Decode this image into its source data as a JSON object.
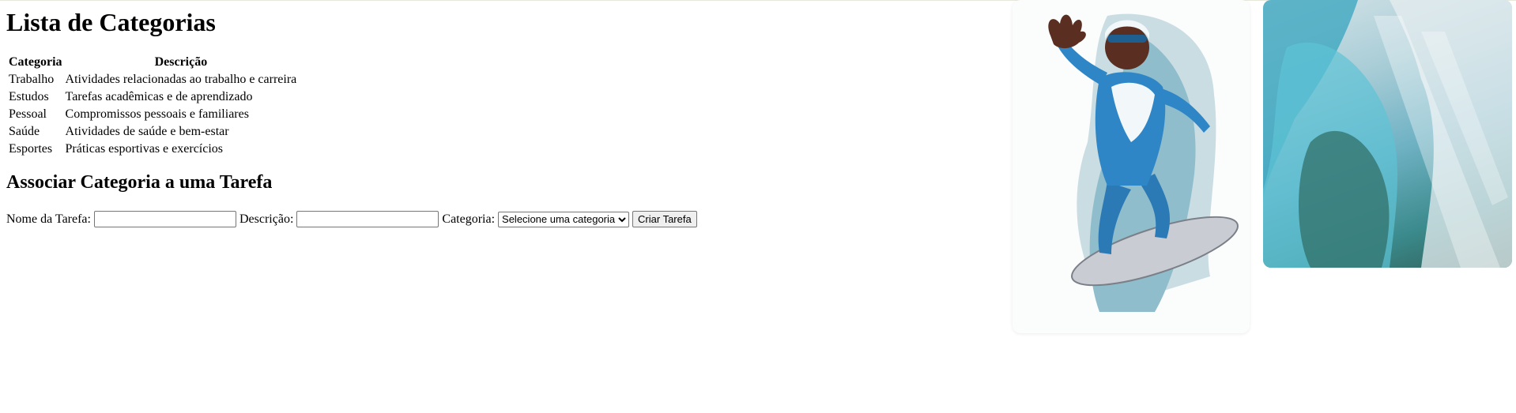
{
  "title": "Lista de Categorias",
  "table": {
    "headers": [
      "Categoria",
      "Descrição"
    ],
    "rows": [
      [
        "Trabalho",
        "Atividades relacionadas ao trabalho e carreira"
      ],
      [
        "Estudos",
        "Tarefas acadêmicas e de aprendizado"
      ],
      [
        "Pessoal",
        "Compromissos pessoais e familiares"
      ],
      [
        "Saúde",
        "Atividades de saúde e bem-estar"
      ],
      [
        "Esportes",
        "Práticas esportivas e exercícios"
      ]
    ]
  },
  "subtitle": "Associar Categoria a uma Tarefa",
  "form": {
    "nome_label": "Nome da Tarefa:",
    "nome_value": "",
    "descricao_label": "Descrição:",
    "descricao_value": "",
    "categoria_label": "Categoria:",
    "categoria_selected": "Selecione uma categoria",
    "submit_label": "Criar Tarefa"
  },
  "images": [
    {
      "name": "superhero-surfing-image"
    },
    {
      "name": "ice-wave-image"
    }
  ]
}
